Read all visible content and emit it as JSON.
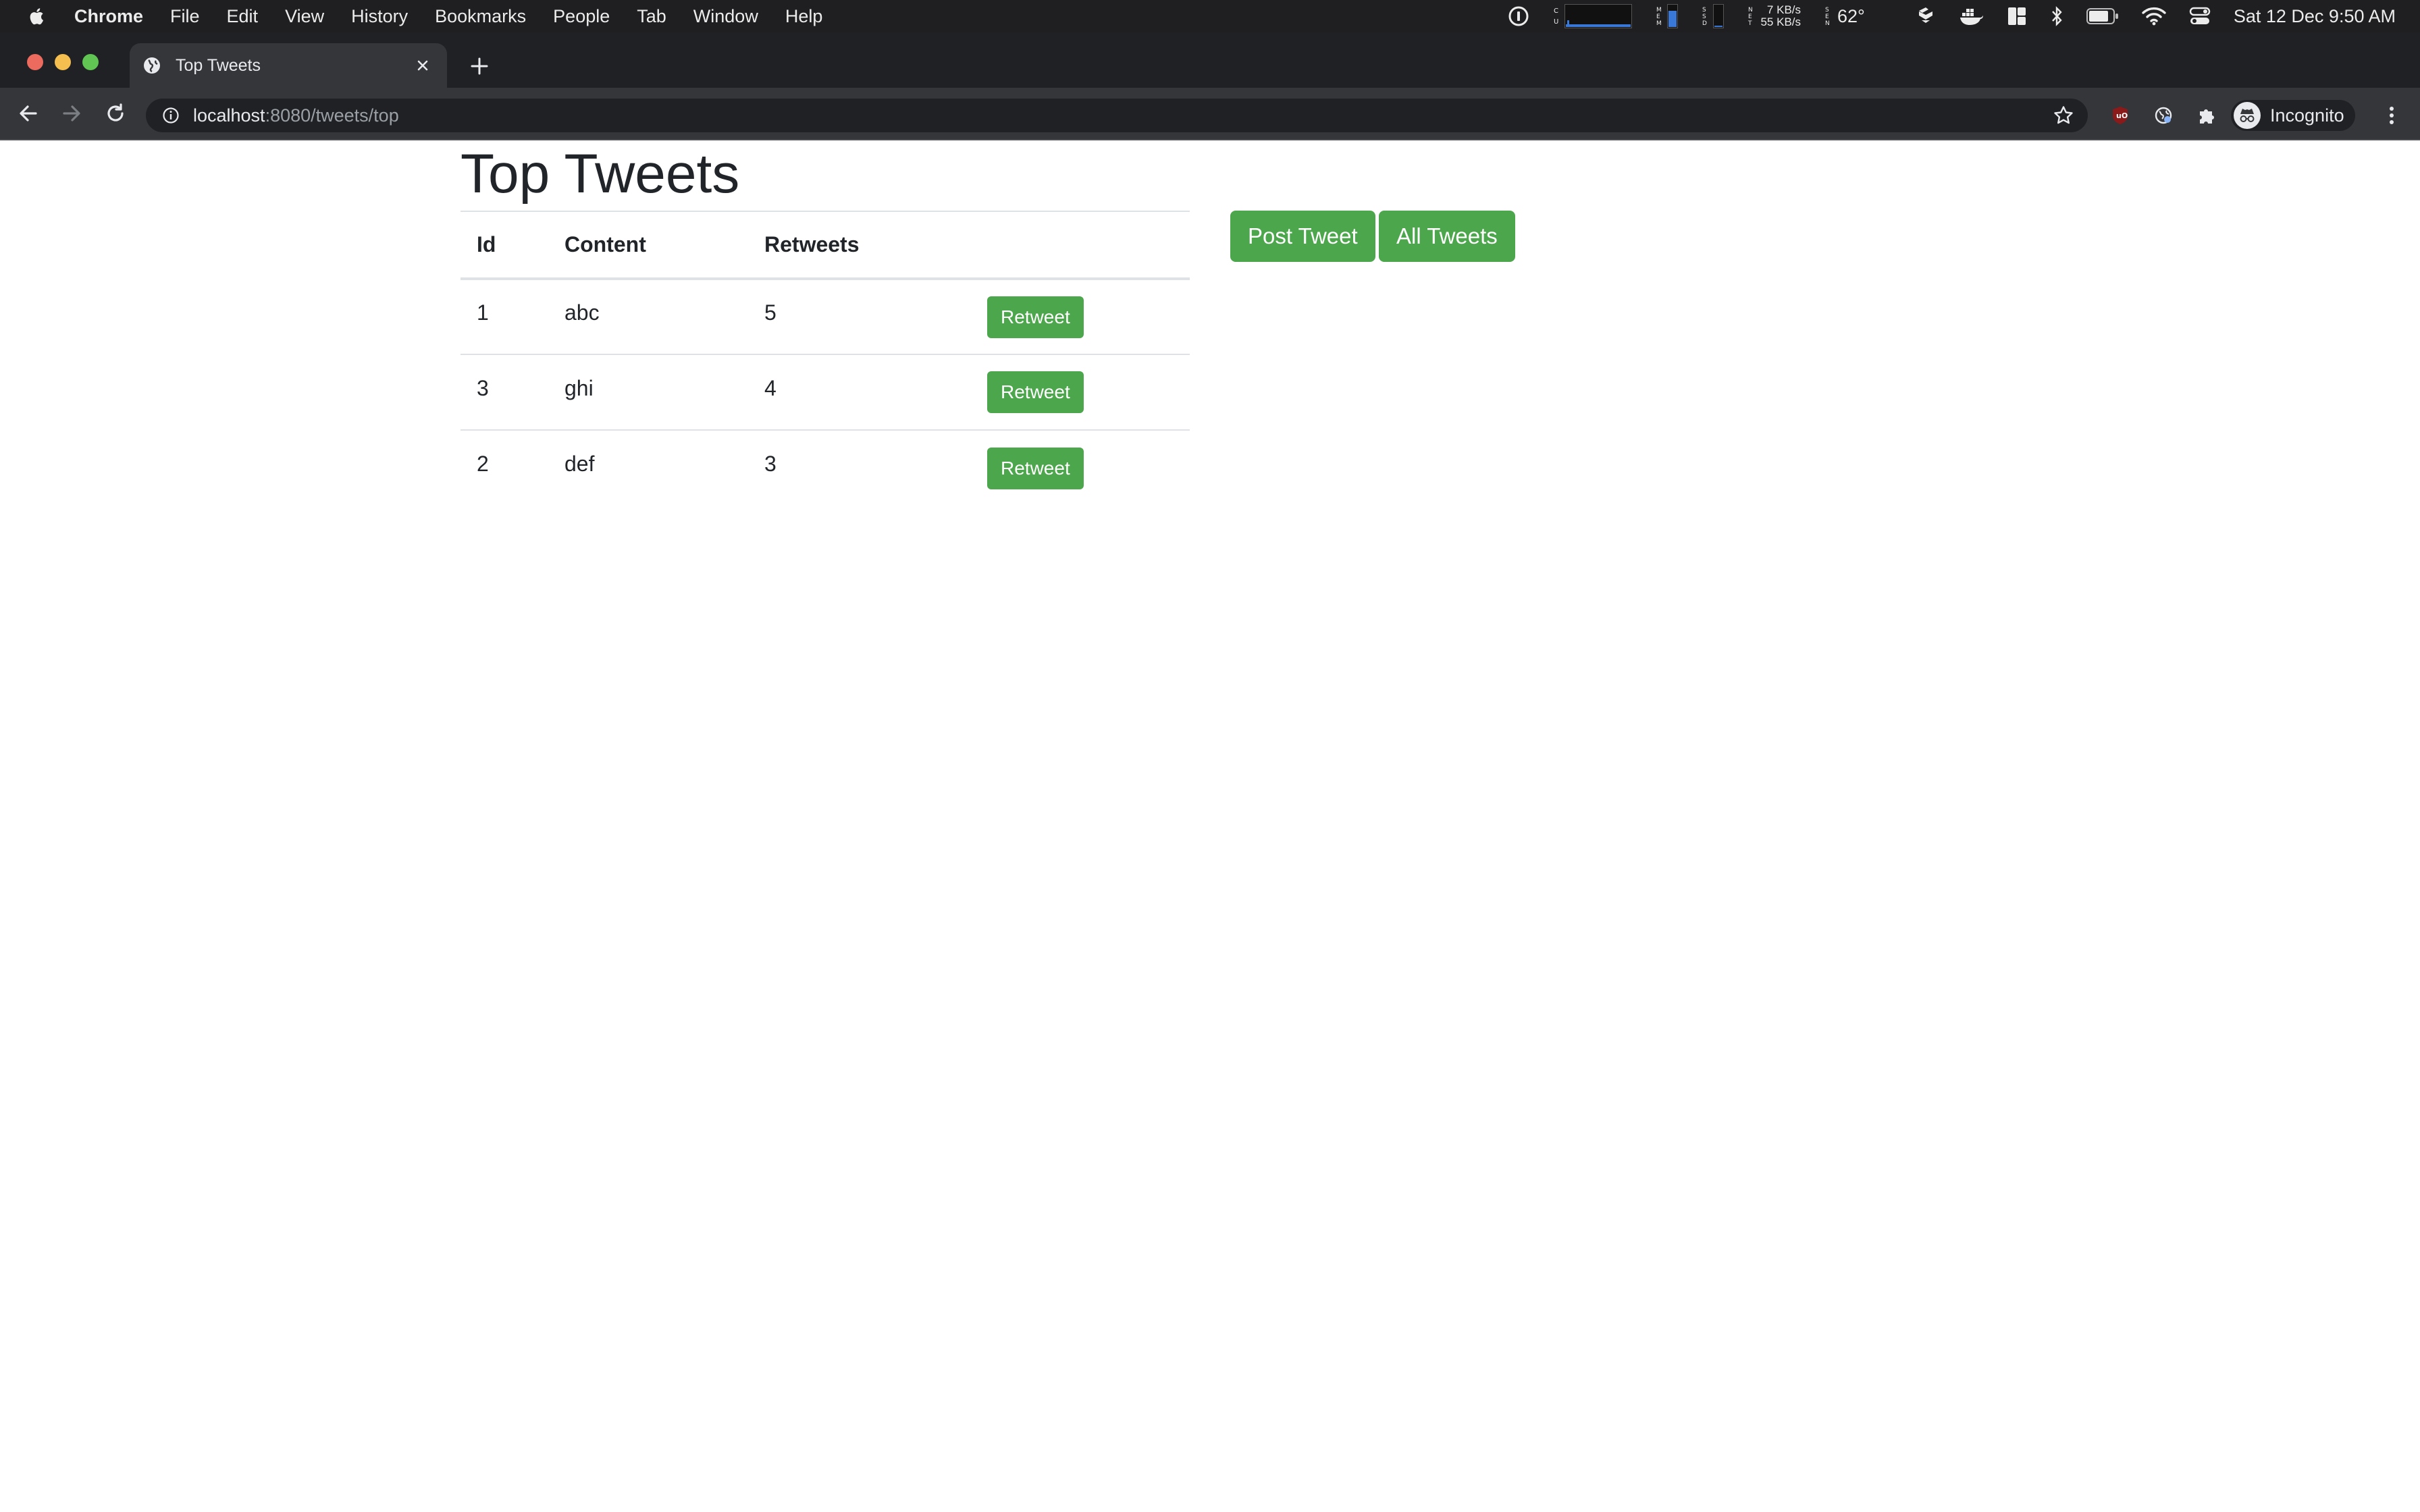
{
  "menubar": {
    "app_name": "Chrome",
    "items": [
      "File",
      "Edit",
      "View",
      "History",
      "Bookmarks",
      "People",
      "Tab",
      "Window",
      "Help"
    ],
    "network": {
      "up": "7 KB/s",
      "down": "55 KB/s"
    },
    "temperature": "62°",
    "clock": "Sat 12 Dec  9:50 AM"
  },
  "browser": {
    "tab_title": "Top Tweets",
    "url_host": "localhost",
    "url_path": ":8080/tweets/top",
    "profile_label": "Incognito"
  },
  "page": {
    "title": "Top Tweets",
    "table": {
      "headers": [
        "Id",
        "Content",
        "Retweets",
        ""
      ],
      "rows": [
        {
          "id": "1",
          "content": "abc",
          "retweets": "5",
          "action": "Retweet"
        },
        {
          "id": "3",
          "content": "ghi",
          "retweets": "4",
          "action": "Retweet"
        },
        {
          "id": "2",
          "content": "def",
          "retweets": "3",
          "action": "Retweet"
        }
      ]
    },
    "buttons": {
      "post_tweet": "Post Tweet",
      "all_tweets": "All Tweets"
    }
  },
  "colors": {
    "button_green": "#4ca64c",
    "text_dark": "#212529",
    "chrome_dark": "#35363a",
    "menubar_bg": "#1f1f21"
  },
  "icons": {
    "menubar": [
      "apple-icon",
      "onepassword-icon",
      "cpu-meter-icon",
      "memory-meter-icon",
      "disk-meter-icon",
      "network-meter-icon",
      "sensor-icon",
      "dropbox-icon",
      "docker-icon",
      "magnet-icon",
      "bluetooth-icon",
      "battery-icon",
      "wifi-icon",
      "control-center-icon"
    ],
    "browser": [
      "globe-favicon-icon",
      "close-icon",
      "plus-icon",
      "back-arrow-icon",
      "forward-arrow-icon",
      "reload-icon",
      "info-icon",
      "star-icon",
      "ublock-icon",
      "extension-globe-icon",
      "puzzle-icon",
      "incognito-icon",
      "kebab-menu-icon"
    ]
  }
}
